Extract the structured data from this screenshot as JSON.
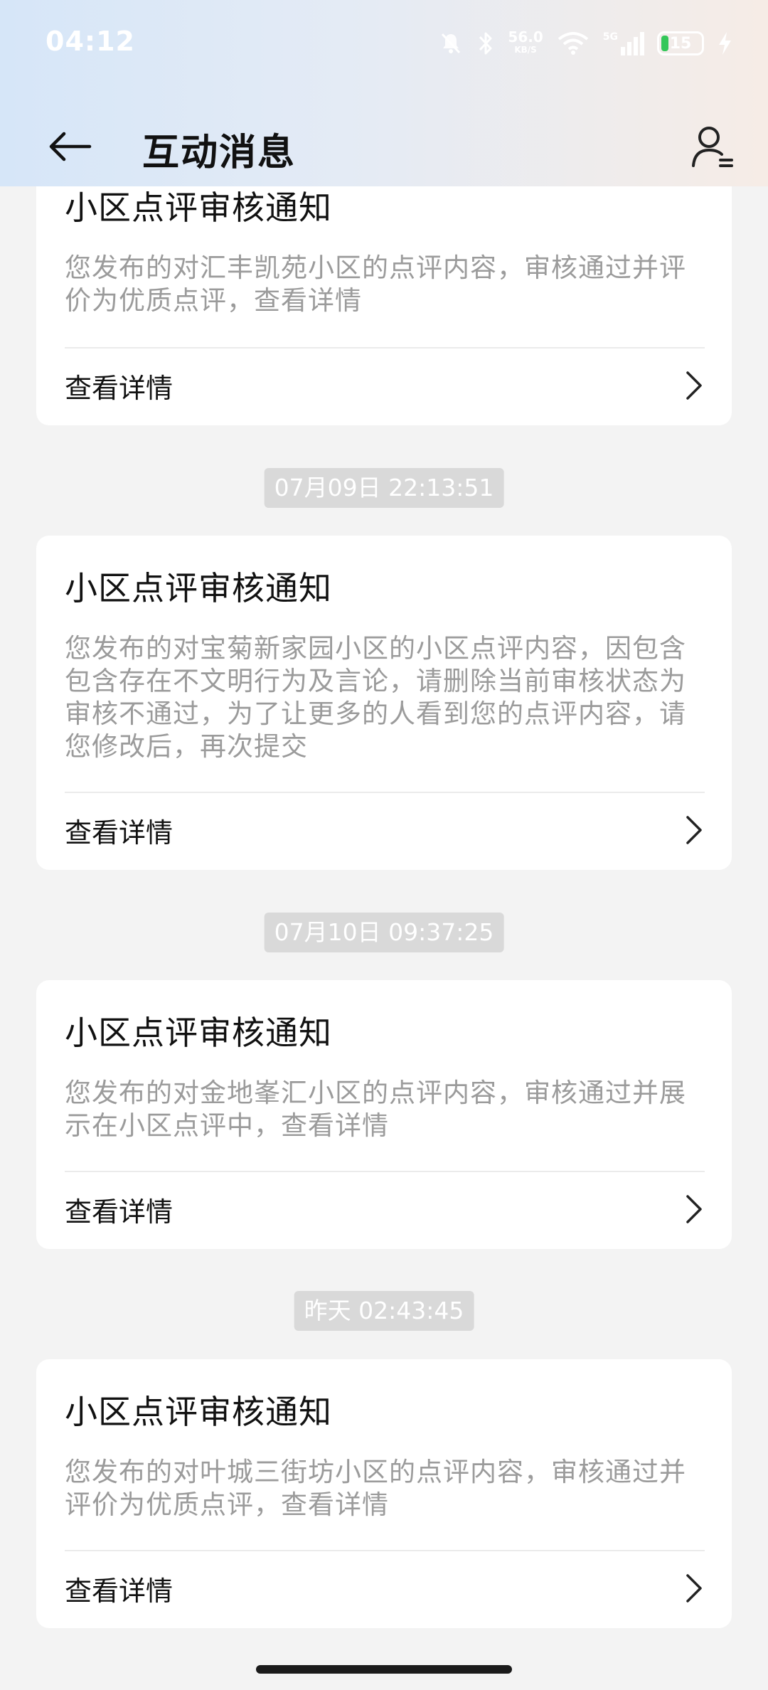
{
  "status_bar": {
    "time": "04:12",
    "net_speed": "56.0",
    "net_unit": "KB/S",
    "signal_label": "5G",
    "battery_level": "15"
  },
  "header": {
    "title": "互动消息"
  },
  "messages": [
    {
      "title": "小区点评审核通知",
      "body": "您发布的对汇丰凯苑小区的点评内容，审核通过并评价为优质点评，查看详情",
      "action": "查看详情"
    },
    {
      "timestamp": "07月09日 22:13:51",
      "title": "小区点评审核通知",
      "body": "您发布的对宝菊新家园小区的小区点评内容，因包含包含存在不文明行为及言论，请删除当前审核状态为审核不通过，为了让更多的人看到您的点评内容，请您修改后，再次提交",
      "action": "查看详情"
    },
    {
      "timestamp": "07月10日 09:37:25",
      "title": "小区点评审核通知",
      "body": "您发布的对金地峯汇小区的点评内容，审核通过并展示在小区点评中，查看详情",
      "action": "查看详情"
    },
    {
      "timestamp": "昨天 02:43:45",
      "title": "小区点评审核通知",
      "body": "您发布的对叶城三街坊小区的点评内容，审核通过并评价为优质点评，查看详情",
      "action": "查看详情"
    }
  ]
}
